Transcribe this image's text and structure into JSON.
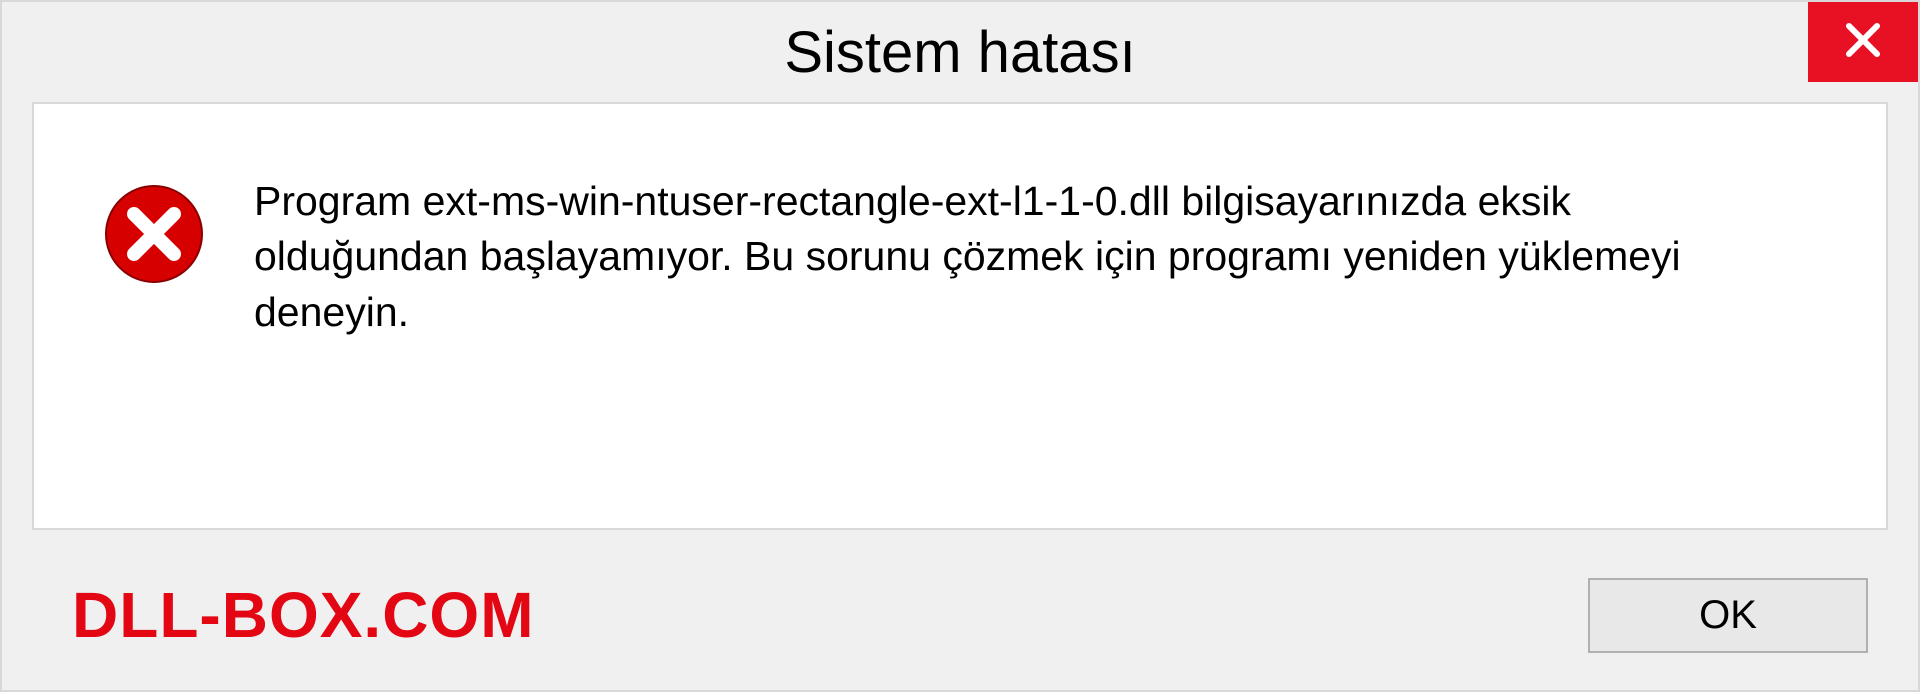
{
  "titlebar": {
    "title": "Sistem hatası"
  },
  "content": {
    "message": "Program ext-ms-win-ntuser-rectangle-ext-l1-1-0.dll bilgisayarınızda eksik olduğundan başlayamıyor. Bu sorunu çözmek için programı yeniden yüklemeyi deneyin."
  },
  "footer": {
    "watermark": "DLL-BOX.COM",
    "ok_label": "OK"
  },
  "icons": {
    "close": "close-icon",
    "error": "error-circle-x-icon"
  },
  "colors": {
    "close_bg": "#e81123",
    "error_red": "#d60000",
    "watermark_red": "#e30613",
    "dialog_bg": "#f0f0f0",
    "content_bg": "#ffffff",
    "border": "#d8d8d8"
  }
}
